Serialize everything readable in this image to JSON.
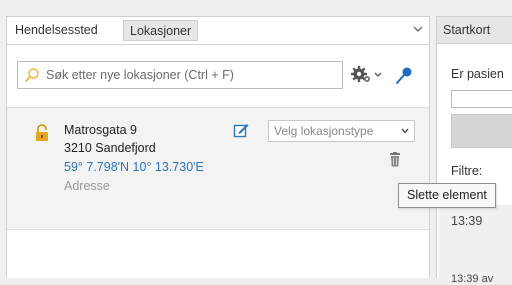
{
  "left_panel": {
    "tabs": [
      {
        "label": "Hendelsessted"
      },
      {
        "label": "Lokasjoner"
      }
    ],
    "collapse_icon": "chevron-down-icon",
    "search": {
      "placeholder": "Søk etter nye lokasjoner (Ctrl + F)",
      "value": "",
      "icon": "search-icon"
    },
    "toolbar": {
      "settings_icon": "gear-icon",
      "pin_icon": "pin-icon"
    },
    "location": {
      "lock_icon": "lock-open-icon",
      "street": "Matrosgata 9",
      "city": "3210 Sandefjord",
      "coordinates": "59° 7.798'N 10° 13.730'E",
      "type": "Adresse",
      "type_select_placeholder": "Velg lokasjonstype",
      "edit_icon": "edit-icon",
      "delete_icon": "trash-icon"
    }
  },
  "right_panel": {
    "tab": "Startkort",
    "question": "Er pasien",
    "filters_label": "Filtre:",
    "time_1": "13:39",
    "time_2": "13:39 av"
  },
  "tooltip": {
    "text": "Slette element"
  },
  "colors": {
    "link_blue": "#2e75b6",
    "lock_gold": "#d89b1c",
    "pin_blue": "#1f6fbf",
    "muted_text": "#999999"
  }
}
